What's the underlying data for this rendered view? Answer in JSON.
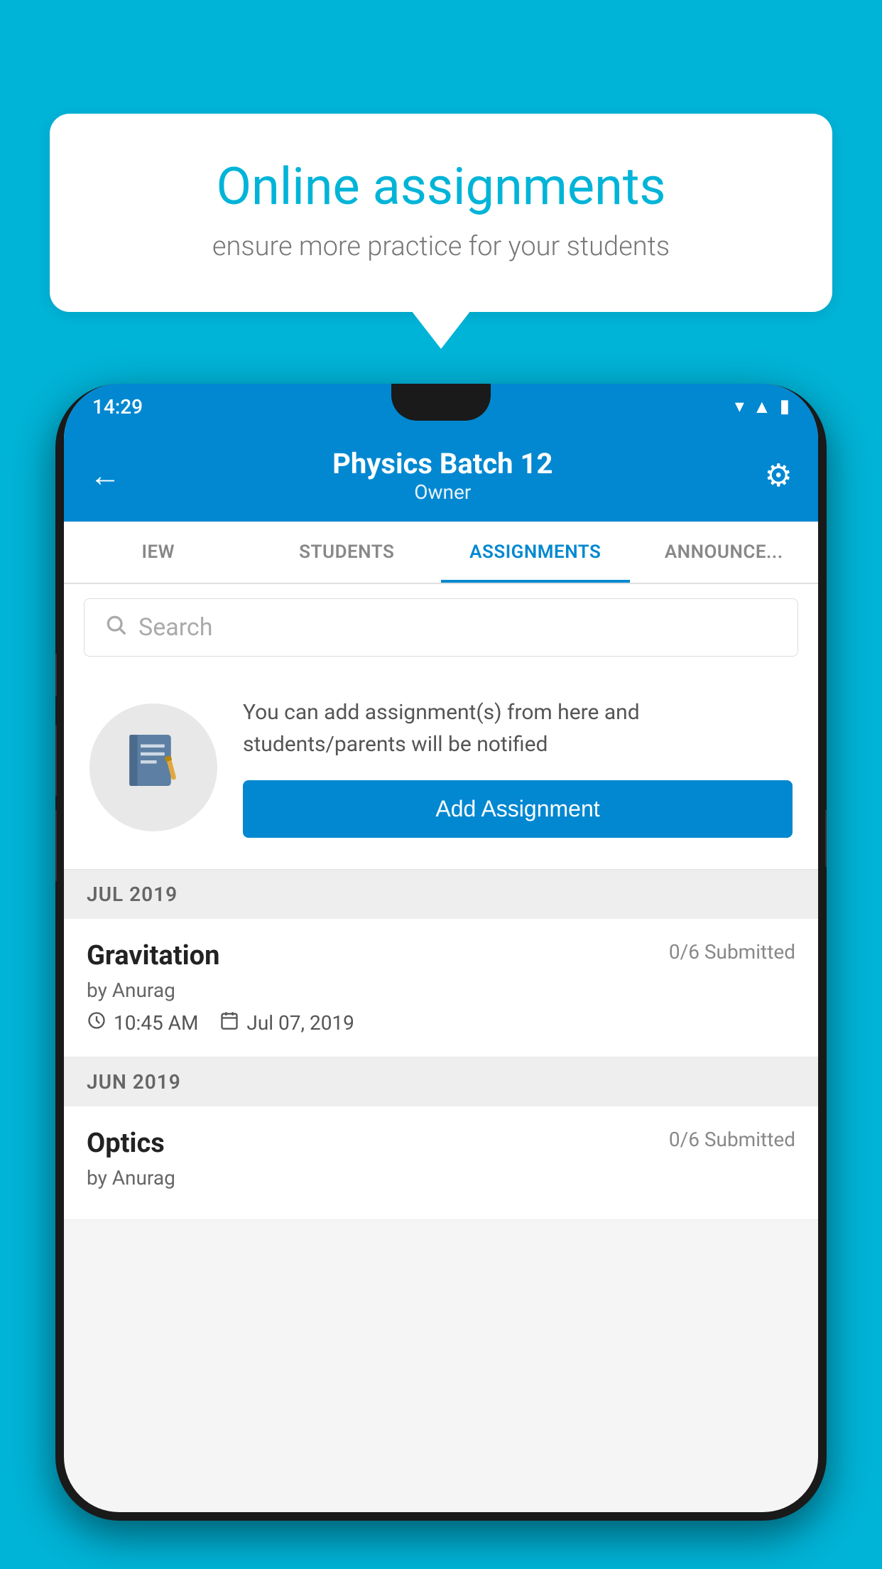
{
  "background_color": "#00B4D8",
  "speech_bubble": {
    "title": "Online assignments",
    "subtitle": "ensure more practice for your students"
  },
  "status_bar": {
    "time": "14:29"
  },
  "app_header": {
    "title": "Physics Batch 12",
    "subtitle": "Owner",
    "back_label": "←",
    "settings_label": "⚙"
  },
  "tabs": [
    {
      "label": "IEW",
      "active": false
    },
    {
      "label": "STUDENTS",
      "active": false
    },
    {
      "label": "ASSIGNMENTS",
      "active": true
    },
    {
      "label": "ANNOUNCEMENTS",
      "active": false
    }
  ],
  "search": {
    "placeholder": "Search"
  },
  "promo": {
    "description": "You can add assignment(s) from here and students/parents will be notified",
    "button_label": "Add Assignment"
  },
  "sections": [
    {
      "label": "JUL 2019",
      "assignments": [
        {
          "title": "Gravitation",
          "submitted": "0/6 Submitted",
          "author": "by Anurag",
          "time": "10:45 AM",
          "date": "Jul 07, 2019"
        }
      ]
    },
    {
      "label": "JUN 2019",
      "assignments": [
        {
          "title": "Optics",
          "submitted": "0/6 Submitted",
          "author": "by Anurag",
          "time": "",
          "date": ""
        }
      ]
    }
  ]
}
